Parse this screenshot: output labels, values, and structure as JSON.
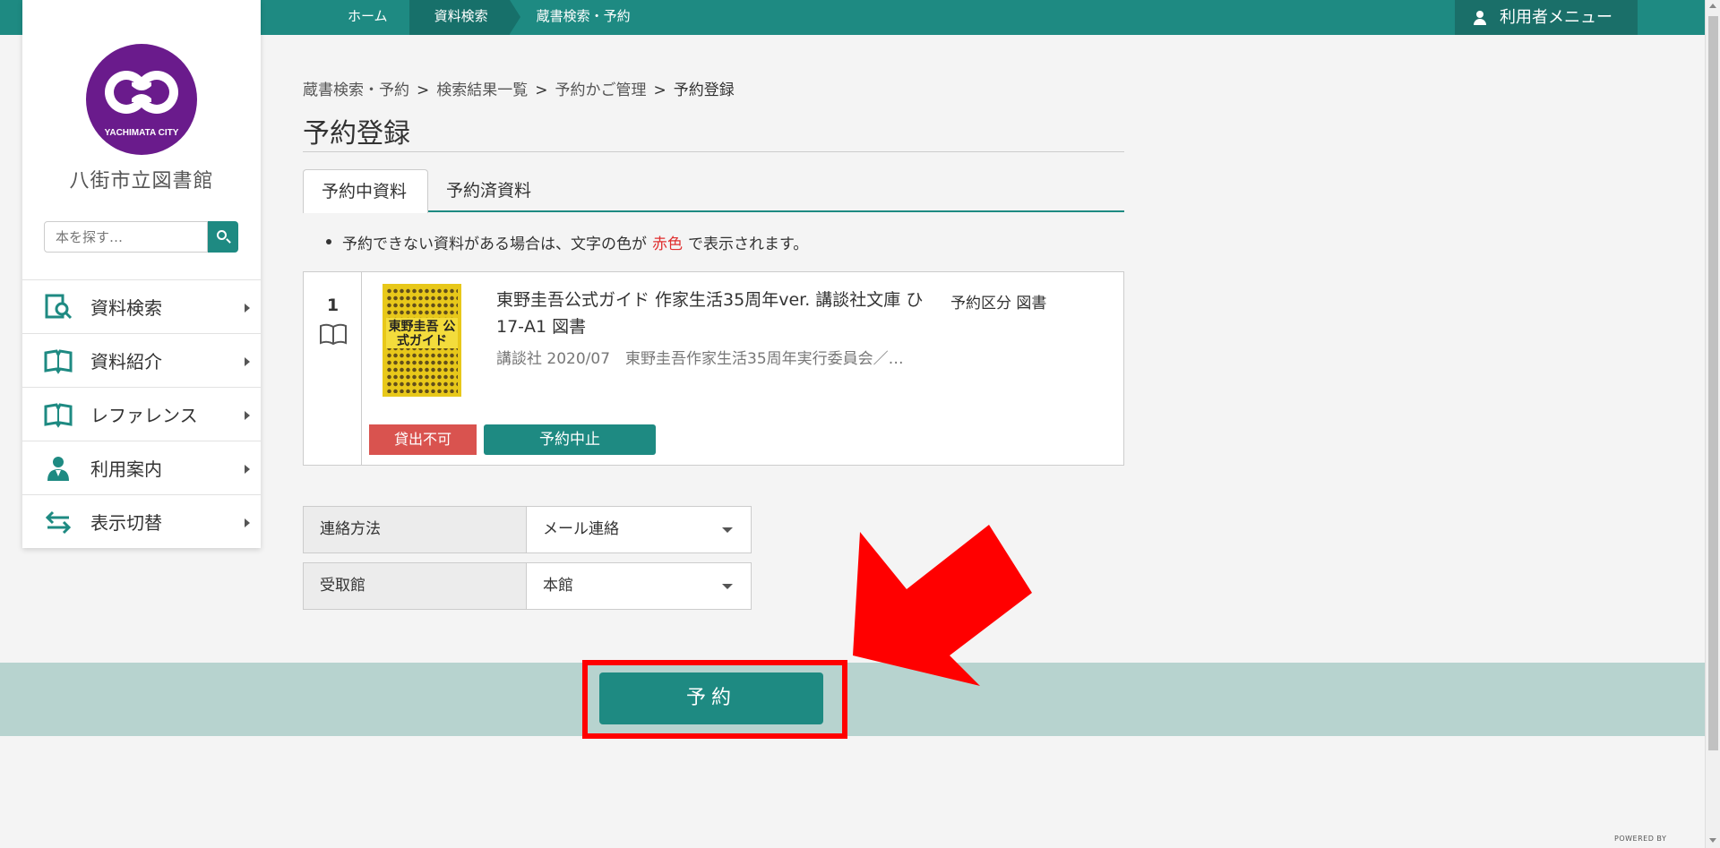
{
  "topnav": {
    "crumbs": [
      {
        "label": "ホーム"
      },
      {
        "label": "資料検索"
      },
      {
        "label": "蔵書検索・予約"
      }
    ],
    "user_menu": "利用者メニュー"
  },
  "sidebar": {
    "logo_text": "YACHIMATA CITY",
    "library_name": "八街市立図書館",
    "search_placeholder": "本を探す…",
    "items": [
      {
        "label": "資料検索",
        "icon": "book-search-icon"
      },
      {
        "label": "資料紹介",
        "icon": "open-book-icon"
      },
      {
        "label": "レファレンス",
        "icon": "open-book-icon"
      },
      {
        "label": "利用案内",
        "icon": "person-icon"
      },
      {
        "label": "表示切替",
        "icon": "swap-arrows-icon"
      }
    ]
  },
  "breadcrumb": {
    "items": [
      "蔵書検索・予約",
      "検索結果一覧",
      "予約かご管理"
    ],
    "separator": ">",
    "current": "予約登録"
  },
  "page_title": "予約登録",
  "tabs": {
    "active": "予約中資料",
    "other": "予約済資料"
  },
  "notice": {
    "before": "予約できない資料がある場合は、文字の色が",
    "red_word": "赤色",
    "after": "で表示されます。"
  },
  "item": {
    "number": "1",
    "cover_text": "東野圭吾 公式ガイド",
    "title": "東野圭吾公式ガイド 作家生活35周年ver. 講談社文庫 ひ17-A1 図書",
    "meta": "講談社 2020/07　東野圭吾作家生活35周年実行委員会／…",
    "kind": "予約区分 図書",
    "status_badge": "貸出不可",
    "cancel_button": "予約中止"
  },
  "form": {
    "contact_label": "連絡方法",
    "contact_value": "メール連絡",
    "pickup_label": "受取館",
    "pickup_value": "本館"
  },
  "submit_button": "予約",
  "powered_by": "POWERED BY",
  "colors": {
    "brand_teal": "#1e8a82",
    "highlight_red": "#ff0000",
    "unavailable_red": "#d9534f",
    "footer_band": "#b7d3cf"
  }
}
